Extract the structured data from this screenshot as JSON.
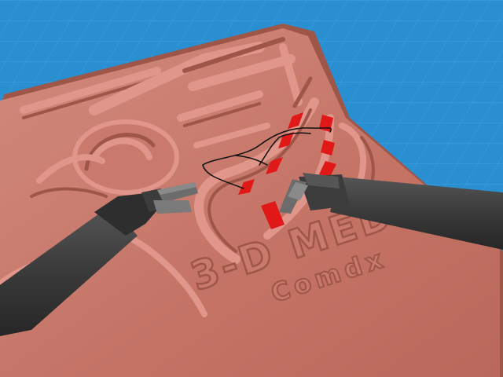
{
  "scene": {
    "embossed_title": "3-D MED",
    "embossed_subtitle": "Comdx"
  },
  "colors": {
    "background_blue": "#2a8fd0",
    "tile_grid": "#3da2e0",
    "tissue_pad": "#c97a6c",
    "tissue_shadow": "#9d5648",
    "tissue_highlight": "#e0968a",
    "target_marker": "#e01818",
    "suture_thread": "#111111",
    "instrument_shaft": "#3a3a3a",
    "instrument_jaw": "#6c6c6c"
  },
  "tools": {
    "left": "left-needle-driver",
    "right": "right-grasper"
  },
  "targets": {
    "count": 8
  }
}
